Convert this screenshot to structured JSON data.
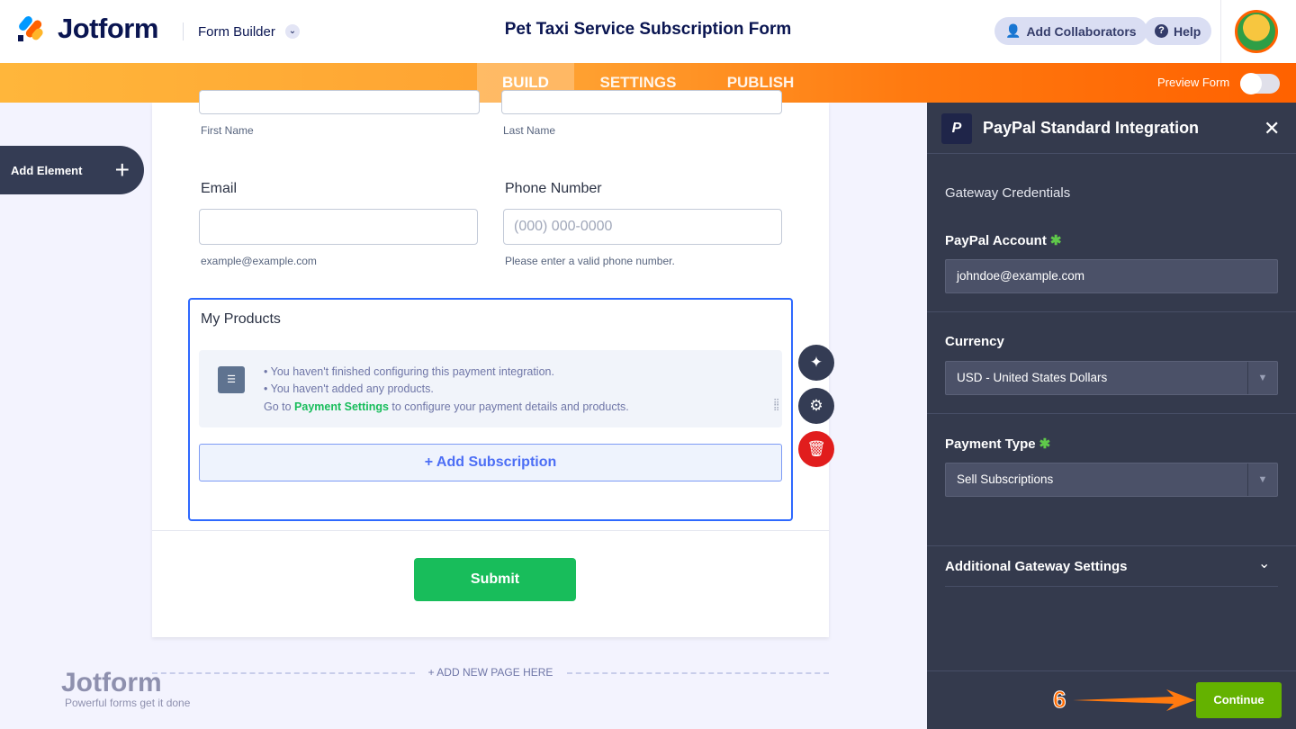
{
  "header": {
    "logo": "Jotform",
    "app_switcher": "Form Builder",
    "form_title": "Pet Taxi Service Subscription Form",
    "add_collaborators": "Add Collaborators",
    "help": "Help"
  },
  "nav": {
    "tabs": [
      "BUILD",
      "SETTINGS",
      "PUBLISH"
    ],
    "active": "BUILD",
    "preview_label": "Preview Form",
    "preview_on": false
  },
  "sidebar": {
    "add_element": "Add Element"
  },
  "form": {
    "first_name_sub": "First Name",
    "last_name_sub": "Last Name",
    "email_label": "Email",
    "email_sub": "example@example.com",
    "phone_label": "Phone Number",
    "phone_placeholder": "(000) 000-0000",
    "phone_sub": "Please enter a valid phone number.",
    "products_label": "My Products",
    "notice_1": "You haven't finished configuring this payment integration.",
    "notice_2": "You haven't added any products.",
    "notice_3_pre": "Go to ",
    "notice_3_link": "Payment Settings",
    "notice_3_post": " to configure your payment details and products.",
    "add_subscription": "+ Add Subscription",
    "submit": "Submit",
    "add_new_page": "+ ADD NEW PAGE HERE",
    "watermark_logo": "Jotform",
    "watermark_tagline": "Powerful forms get it done"
  },
  "panel": {
    "title": "PayPal Standard Integration",
    "section": "Gateway Credentials",
    "account_label": "PayPal Account",
    "account_value": "johndoe@example.com",
    "currency_label": "Currency",
    "currency_value": "USD - United States Dollars",
    "payment_type_label": "Payment Type",
    "payment_type_value": "Sell Subscriptions",
    "additional": "Additional Gateway Settings",
    "continue": "Continue"
  },
  "annotation": {
    "step": "6"
  }
}
